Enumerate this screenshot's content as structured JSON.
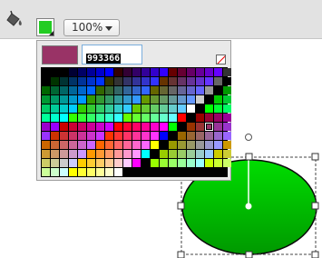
{
  "toolbar": {
    "bucket_icon": "paint-bucket-icon",
    "fill_color": "#22cc22",
    "zoom_value": "100%"
  },
  "color_picker": {
    "preview_color": "#993366",
    "hex_value": "993366",
    "no_color_icon": "no-color-icon",
    "selected_swatch": "#993366"
  },
  "canvas": {
    "shape": "ellipse",
    "fill_top": "#00dd00",
    "fill_bottom": "#009900"
  }
}
